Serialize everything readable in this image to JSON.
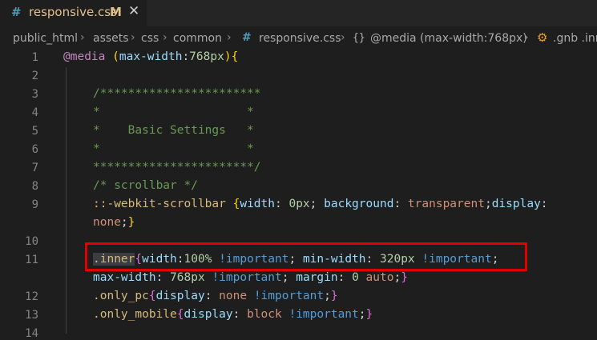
{
  "tab": {
    "hash": "#",
    "filename": "responsive.css",
    "modified": "M",
    "close": "✕"
  },
  "breadcrumb": {
    "parts": [
      "public_html",
      "assets",
      "css",
      "common",
      "responsive.css",
      "@media (max-width:768px)",
      ".gnb .inr"
    ],
    "hash": "#",
    "braces": "{}",
    "separator": "›"
  },
  "lines": {
    "n1": "1",
    "n2": "2",
    "n3": "3",
    "n4": "4",
    "n5": "5",
    "n6": "6",
    "n7": "7",
    "n8": "8",
    "n9": "9",
    "n10": "10",
    "n11": "11",
    "n12": "12",
    "n13": "13",
    "n14": "14"
  },
  "code": {
    "l1_at": "@media",
    "l1_paren": "(",
    "l1_prop": "max-width",
    "l1_colon": ":",
    "l1_num": "768px",
    "l1_close": ")",
    "l1_brace": "{",
    "l3": "/***********************",
    "l4": "*                     *",
    "l5": "*    Basic Settings   *",
    "l6": "*                     *",
    "l7": "***********************/",
    "l8": "/* scrollbar */",
    "l9_sel": "::-webkit-scrollbar",
    "l9_brace": "{",
    "l9_p1": "width",
    "l9_v1": "0px",
    "l9_p2": "background",
    "l9_v2": "transparent",
    "l9_p3": "display",
    "l9b_val": "none",
    "l9b_brace": "}",
    "l11_sel": ".inner",
    "l11_brace": "{",
    "l11_p1": "width",
    "l11_v1": "100%",
    "l11_imp1": "!important",
    "l11_p2": "min-width",
    "l11_v2": "320px",
    "l11_imp2": "!important",
    "l11b_p": "max-width",
    "l11b_v": "768px",
    "l11b_imp": "!important",
    "l11b_p2": "margin",
    "l11b_v2": "0",
    "l11b_v3": "auto",
    "l11b_brace": "}",
    "l12_sel": ".only_pc",
    "l12_p": "display",
    "l12_v": "none",
    "l12_imp": "!important",
    "l13_sel": ".only_mobile",
    "l13_p": "display",
    "l13_v": "block",
    "l13_imp": "!important"
  },
  "colors": {
    "highlight_box": "#e00000",
    "background": "#1e1e1e"
  }
}
